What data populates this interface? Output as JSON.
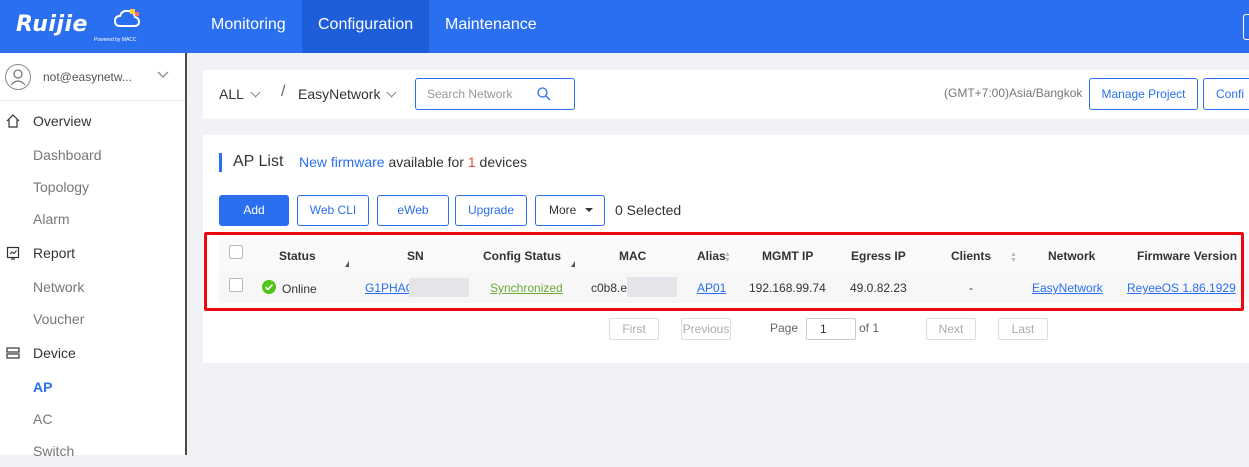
{
  "app": {
    "logo_text": "Ruijie",
    "logo_sub": "Powered by MACC"
  },
  "nav": {
    "items": [
      {
        "label": "Monitoring",
        "active": false
      },
      {
        "label": "Configuration",
        "active": true
      },
      {
        "label": "Maintenance",
        "active": false
      }
    ]
  },
  "user": {
    "name": "not@easynetw..."
  },
  "sidebar": {
    "items": [
      {
        "label": "Overview",
        "type": "group",
        "icon": "home-icon"
      },
      {
        "label": "Dashboard",
        "type": "sub"
      },
      {
        "label": "Topology",
        "type": "sub"
      },
      {
        "label": "Alarm",
        "type": "sub"
      },
      {
        "label": "Report",
        "type": "group",
        "icon": "report-icon"
      },
      {
        "label": "Network",
        "type": "sub"
      },
      {
        "label": "Voucher",
        "type": "sub"
      },
      {
        "label": "Device",
        "type": "group",
        "icon": "device-icon"
      },
      {
        "label": "AP",
        "type": "sub",
        "active": true
      },
      {
        "label": "AC",
        "type": "sub"
      },
      {
        "label": "Switch",
        "type": "sub"
      }
    ]
  },
  "filter": {
    "scope": "ALL",
    "separator": "/",
    "network": "EasyNetwork",
    "search_placeholder": "Search Network",
    "timezone": "(GMT+7:00)Asia/Bangkok",
    "manage_project": "Manage Project",
    "config_partial": "Confi"
  },
  "ap_list": {
    "title": "AP List",
    "fw_link": "New firmware",
    "fw_text_1": "available for",
    "fw_count": "1",
    "fw_text_2": "devices",
    "buttons": {
      "add": "Add",
      "web_cli": "Web CLI",
      "eweb": "eWeb",
      "upgrade": "Upgrade",
      "more": "More"
    },
    "selected": "0 Selected",
    "columns": [
      "Status",
      "SN",
      "Config Status",
      "MAC",
      "Alias",
      "MGMT IP",
      "Egress IP",
      "Clients",
      "Network",
      "Firmware Version"
    ],
    "rows": [
      {
        "status": "Online",
        "sn": "G1PHAC",
        "config_status": "Synchronized",
        "mac": "c0b8.e",
        "alias": "AP01",
        "mgmt_ip": "192.168.99.74",
        "egress_ip": "49.0.82.23",
        "clients": "-",
        "network": "EasyNetwork",
        "firmware": "ReyeeOS 1.86.1929"
      }
    ],
    "pager": {
      "first": "First",
      "previous": "Previous",
      "page_label": "Page",
      "page_value": "1",
      "of_label": "of 1",
      "next": "Next",
      "last": "Last"
    }
  },
  "colors": {
    "brand": "#2a6fef",
    "highlight": "#e8090f",
    "online": "#52c41a",
    "sync": "#6aab3a"
  }
}
